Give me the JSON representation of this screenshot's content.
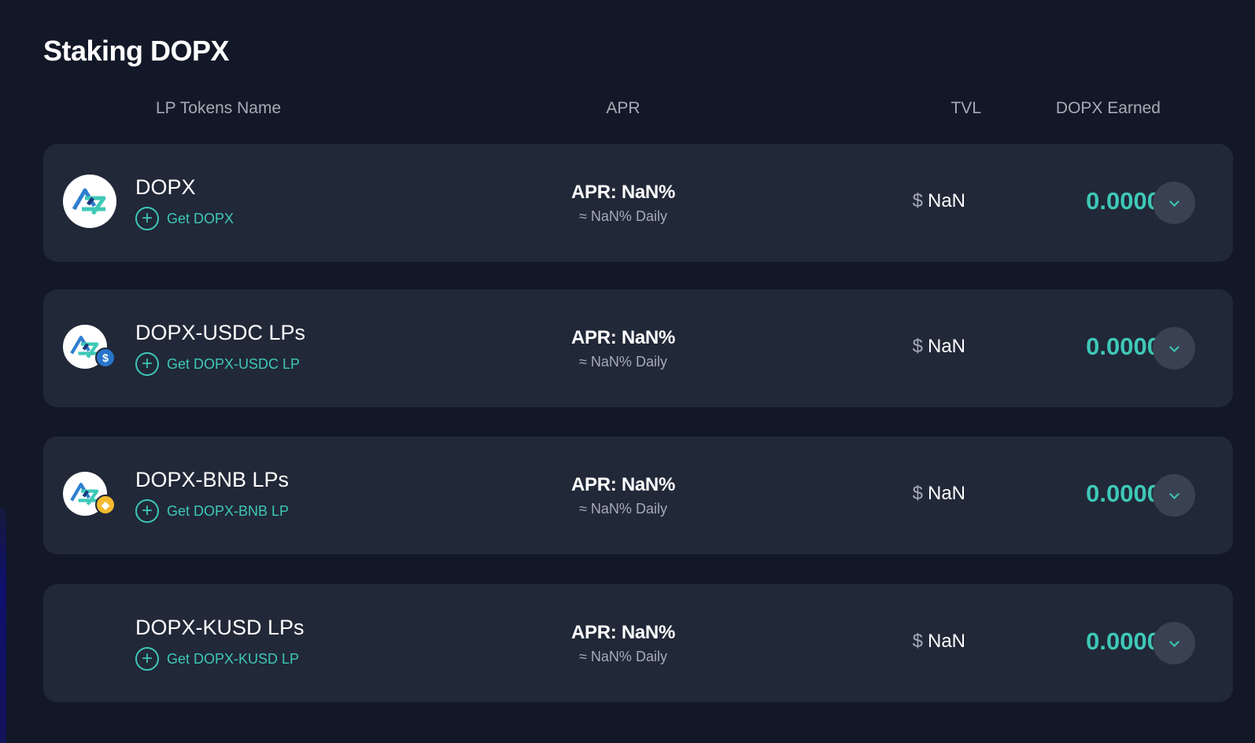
{
  "page": {
    "title": "Staking DOPX"
  },
  "columns": {
    "name": "LP Tokens Name",
    "apr": "APR",
    "tvl": "TVL",
    "earned": "DOPX Earned"
  },
  "pools": [
    {
      "name": "DOPX",
      "get_label": "Get DOPX",
      "apr": "APR: NaN%",
      "daily": "≈ NaN% Daily",
      "currency": "$",
      "tvl": "NaN",
      "earned": "0.0000",
      "logo": "dopx-logo-icon",
      "badge": ""
    },
    {
      "name": "DOPX-USDC LPs",
      "get_label": "Get DOPX-USDC LP",
      "apr": "APR: NaN%",
      "daily": "≈ NaN% Daily",
      "currency": "$",
      "tvl": "NaN",
      "earned": "0.0000",
      "logo": "dopx-logo-icon",
      "badge": "usdc-badge-icon"
    },
    {
      "name": "DOPX-BNB LPs",
      "get_label": "Get DOPX-BNB LP",
      "apr": "APR: NaN%",
      "daily": "≈ NaN% Daily",
      "currency": "$",
      "tvl": "NaN",
      "earned": "0.0000",
      "logo": "dopx-logo-icon",
      "badge": "bnb-badge-icon"
    },
    {
      "name": "DOPX-KUSD LPs",
      "get_label": "Get DOPX-KUSD LP",
      "apr": "APR: NaN%",
      "daily": "≈ NaN% Daily",
      "currency": "$",
      "tvl": "NaN",
      "earned": "0.0000",
      "logo": "",
      "badge": ""
    }
  ],
  "colors": {
    "background": "#121827",
    "card": "#212838",
    "accent": "#3ec8b7",
    "muted_text": "#a6abb6",
    "button": "#3a4252"
  }
}
